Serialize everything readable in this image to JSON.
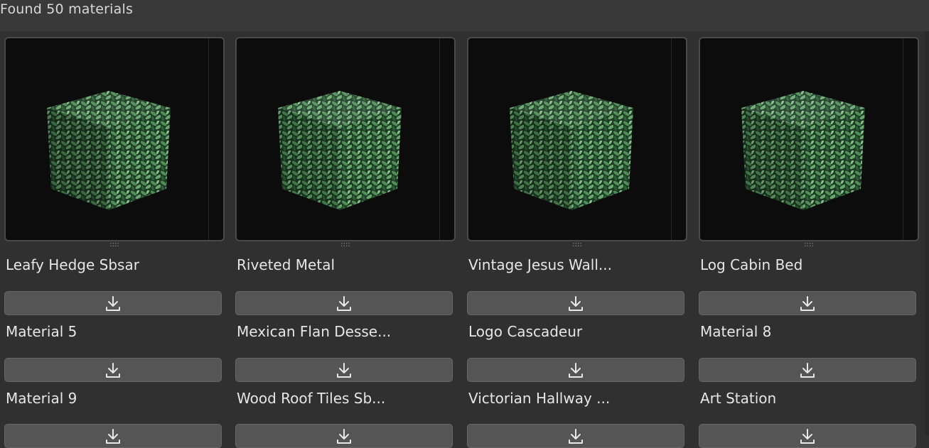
{
  "header": {
    "found_text": "Found 50 materials"
  },
  "grip": "::::",
  "columns": [
    {
      "rows": [
        "Leafy Hedge Sbsar",
        "Material 5",
        "Material 9"
      ]
    },
    {
      "rows": [
        "Riveted Metal",
        "Mexican Flan Desse...",
        "Wood Roof Tiles Sb..."
      ]
    },
    {
      "rows": [
        "Vintage Jesus Wall...",
        "Logo Cascadeur",
        "Victorian Hallway ..."
      ]
    },
    {
      "rows": [
        "Log Cabin Bed",
        "Material 8",
        "Art Station"
      ]
    }
  ],
  "icons": {
    "download": "download-icon",
    "preview": "hedge-cube-thumbnail"
  },
  "colors": {
    "background": "#303030",
    "header": "#393939",
    "button": "#555555",
    "preview_bg": "#0c0c0c",
    "foliage": "#3f7a45"
  }
}
